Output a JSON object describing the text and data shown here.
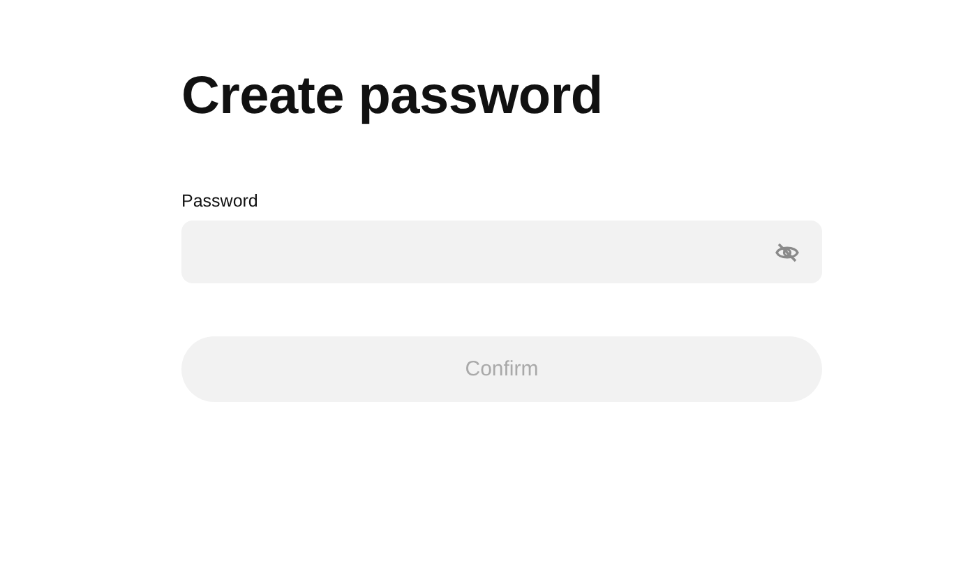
{
  "title": "Create password",
  "password_field": {
    "label": "Password",
    "password_visible": false
  },
  "confirm_button": {
    "label": "Confirm",
    "disabled": true
  }
}
